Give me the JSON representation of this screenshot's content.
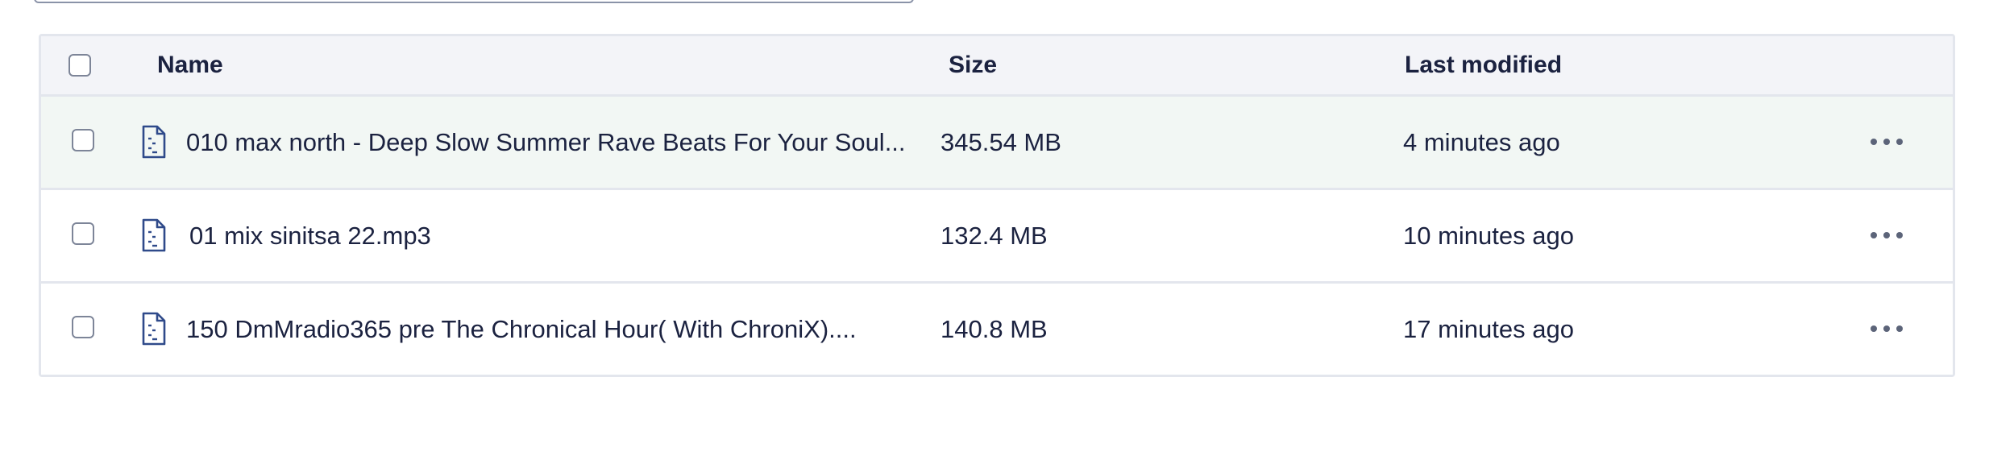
{
  "table": {
    "columns": {
      "name": "Name",
      "size": "Size",
      "modified": "Last modified"
    },
    "rows": [
      {
        "name": "010 max north - Deep Slow Summer Rave Beats For Your Soul...",
        "size": "345.54 MB",
        "modified": "4 minutes ago",
        "icon": "audio-file-icon",
        "highlighted": true
      },
      {
        "name": "01 mix sinitsa 22.mp3",
        "size": "132.4 MB",
        "modified": "10 minutes ago",
        "icon": "audio-file-icon",
        "highlighted": false
      },
      {
        "name": "150 DmMradio365 pre The Chronical Hour( With ChroniX)....",
        "size": "140.8 MB",
        "modified": "17 minutes ago",
        "icon": "audio-file-icon",
        "highlighted": false
      }
    ]
  },
  "colors": {
    "text": "#1b2240",
    "header_bg": "#f3f4f8",
    "highlight_bg": "#f2f7f4",
    "border": "#e3e6ed",
    "icon": "#2f4a8a"
  }
}
